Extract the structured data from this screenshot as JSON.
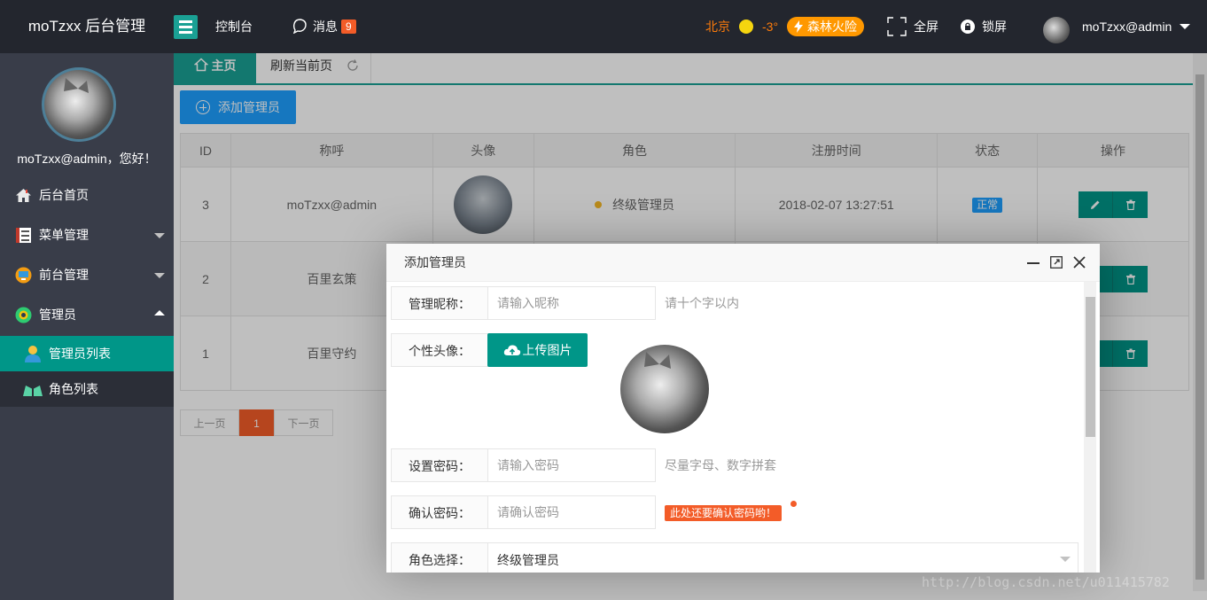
{
  "header": {
    "logo": "moTzxx 后台管理",
    "console": "控制台",
    "messages": "消息",
    "message_count": "9",
    "city": "北京",
    "temperature": "-3°",
    "alert": "森林火险",
    "fullscreen": "全屏",
    "lock": "锁屏",
    "user": "moTzxx@admin"
  },
  "sidebar": {
    "greeting": "moTzxx@admin，您好！",
    "items": [
      {
        "label": "后台首页"
      },
      {
        "label": "菜单管理"
      },
      {
        "label": "前台管理"
      },
      {
        "label": "管理员"
      }
    ],
    "subitems": [
      {
        "label": "管理员列表"
      },
      {
        "label": "角色列表"
      }
    ]
  },
  "tabs": {
    "home": "主页",
    "refresh": "刷新当前页"
  },
  "content": {
    "add_button": "添加管理员",
    "columns": [
      "ID",
      "称呼",
      "头像",
      "角色",
      "注册时间",
      "状态",
      "操作"
    ],
    "rows": [
      {
        "id": "3",
        "name": "moTzxx@admin",
        "role": "终级管理员",
        "time": "2018-02-07 13:27:51",
        "status": "正常"
      },
      {
        "id": "2",
        "name": "百里玄策"
      },
      {
        "id": "1",
        "name": "百里守约"
      }
    ],
    "pager": {
      "prev": "上一页",
      "current": "1",
      "next": "下一页"
    }
  },
  "dialog": {
    "title": "添加管理员",
    "nickname_label": "管理昵称：",
    "nickname_placeholder": "请输入昵称",
    "nickname_hint": "请十个字以内",
    "avatar_label": "个性头像：",
    "upload_button": "上传图片",
    "password_label": "设置密码：",
    "password_placeholder": "请输入密码",
    "password_hint": "尽量字母、数字拼套",
    "confirm_label": "确认密码：",
    "confirm_placeholder": "请确认密码",
    "confirm_error": "此处还要确认密码哟！",
    "role_label": "角色选择：",
    "role_value": "终级管理员"
  },
  "watermark": "http://blog.csdn.net/u011415782",
  "colors": {
    "header_bg": "#23262e",
    "sidebar_bg": "#393d49",
    "accent": "#009688",
    "primary": "#1e9fff",
    "danger": "#f35c28",
    "weather": "#ff7c0a"
  }
}
